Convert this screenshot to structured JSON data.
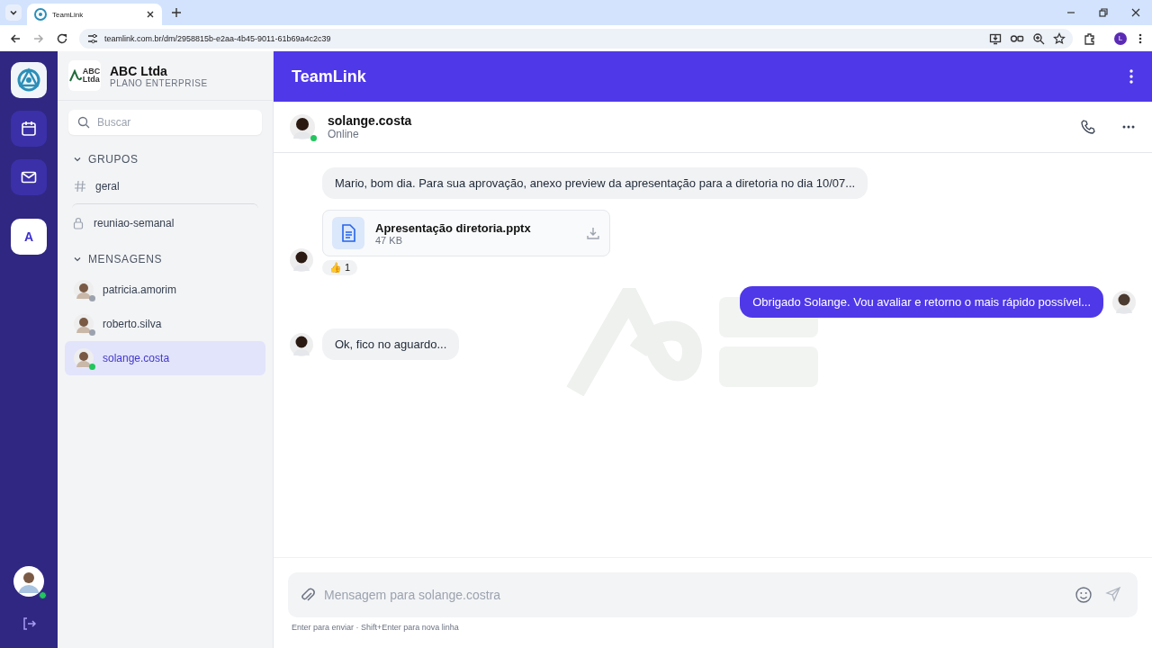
{
  "browser": {
    "tab_title": "TeamLink",
    "url": "teamlink.com.br/dm/2958815b-e2aa-4b45-9011-61b69a4c2c39",
    "profile_initial": "L"
  },
  "rail": {
    "items": [
      {
        "kind": "app-logo",
        "selected": false
      },
      {
        "kind": "calendar",
        "selected": false
      },
      {
        "kind": "mail",
        "selected": false
      },
      {
        "kind": "workspace",
        "label": "A",
        "selected": true
      }
    ],
    "user": {
      "color": "#22c55e"
    }
  },
  "workspace": {
    "logo_top": "ABC",
    "logo_bottom": "Ltda",
    "name": "ABC Ltda",
    "plan": "PLANO ENTERPRISE"
  },
  "search": {
    "placeholder": "Buscar"
  },
  "sections": [
    {
      "title": "GRUPOS",
      "expanded": true,
      "items": [
        {
          "kind": "channel",
          "label": "geral",
          "selected": false
        },
        {
          "kind": "private",
          "label": "reuniao-semanal",
          "selected": false
        }
      ]
    },
    {
      "title": "MENSAGENS",
      "expanded": true,
      "items": [
        {
          "kind": "dm",
          "label": "patricia.amorim",
          "color": "#9ca3af",
          "selected": false
        },
        {
          "kind": "dm",
          "label": "roberto.silva",
          "color": "#9ca3af",
          "selected": false
        },
        {
          "kind": "dm",
          "label": "solange.costa",
          "color": "#22c55e",
          "selected": true
        }
      ]
    }
  ],
  "app_title": "TeamLink",
  "chat": {
    "name": "solange.costa",
    "status": "Online",
    "color": "#22c55e"
  },
  "messages": [
    {
      "kind": "text",
      "mine": false,
      "text": "Mario, bom dia. Para sua aprovação, anexo preview da apresentação para a diretoria no dia 10/07...",
      "avatar": false
    },
    {
      "kind": "file",
      "mine": false,
      "file_name": "Apresentação diretoria.pptx",
      "file_size": "47 KB",
      "reaction": "👍",
      "reaction_count": "1",
      "avatar": true
    },
    {
      "kind": "text",
      "mine": true,
      "text": "Obrigado Solange. Vou avaliar e retorno o mais rápido possível...",
      "avatar": true
    },
    {
      "kind": "text",
      "mine": false,
      "text": "Ok, fico no aguardo...",
      "avatar": true
    }
  ],
  "composer": {
    "placeholder": "Mensagem para solange.costra",
    "hint": "Enter para enviar · Shift+Enter para nova linha"
  }
}
